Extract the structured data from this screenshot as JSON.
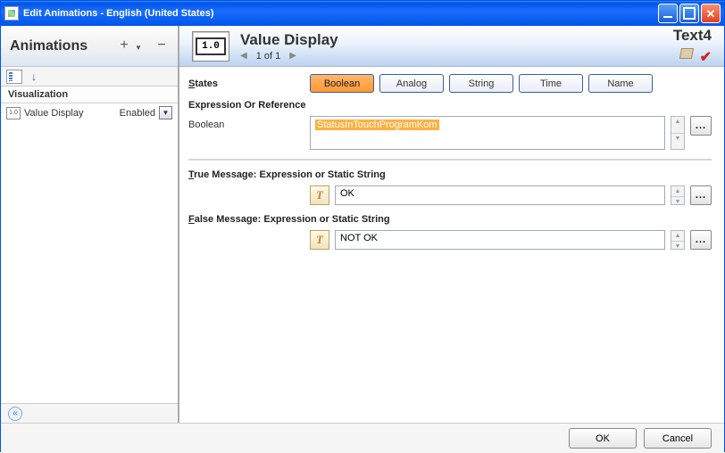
{
  "window": {
    "title": "Edit Animations - English (United States)"
  },
  "sidebar": {
    "title": "Animations",
    "section": "Visualization",
    "items": [
      {
        "label": "Value Display",
        "status": "Enabled"
      }
    ]
  },
  "header": {
    "icon_text": "1.0",
    "title": "Value Display",
    "pager": "1 of 1",
    "object_name": "Text4"
  },
  "form": {
    "states_label": "States",
    "tabs": {
      "boolean": "Boolean",
      "analog": "Analog",
      "string": "String",
      "time": "Time",
      "name": "Name"
    },
    "expr_label": "Expression Or Reference",
    "expr_type": "Boolean",
    "expr_value": "StatusInTouchProgramKom",
    "true_label": "True Message: Expression or Static String",
    "true_value": "OK",
    "false_label": "False Message: Expression or Static String",
    "false_value": "NOT OK"
  },
  "buttons": {
    "ok": "OK",
    "cancel": "Cancel",
    "browse": "..."
  }
}
